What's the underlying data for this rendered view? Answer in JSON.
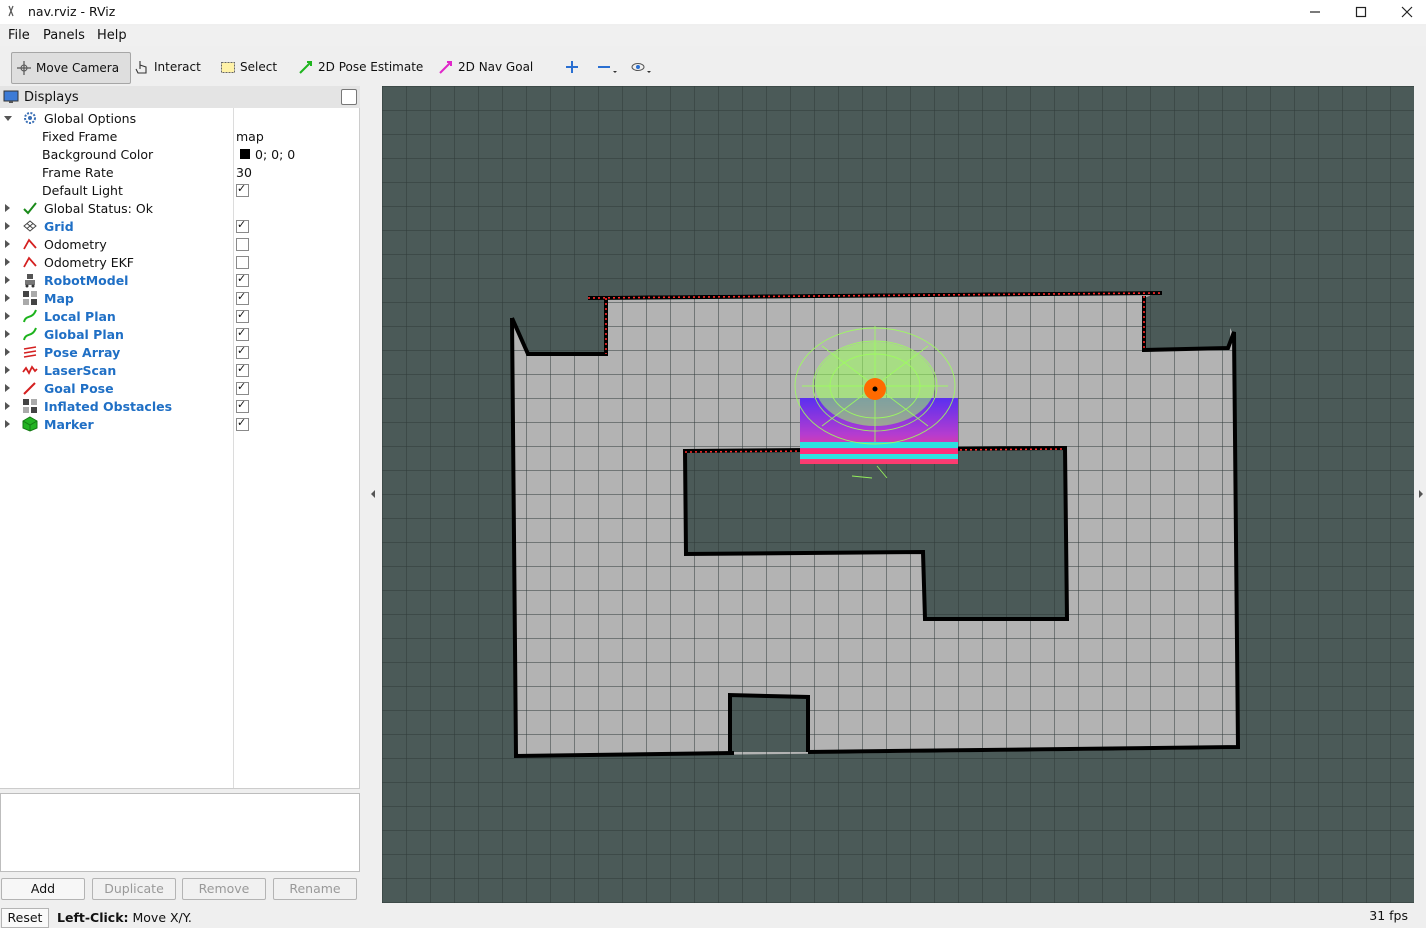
{
  "window": {
    "title": "nav.rviz - RViz"
  },
  "menu": {
    "file": "File",
    "panels": "Panels",
    "help": "Help"
  },
  "toolbar": {
    "move_camera": "Move Camera",
    "interact": "Interact",
    "select": "Select",
    "pose_estimate": "2D Pose Estimate",
    "nav_goal": "2D Nav Goal"
  },
  "displays": {
    "header": "Displays",
    "global_options": "Global Options",
    "fixed_frame_label": "Fixed Frame",
    "fixed_frame_value": "map",
    "bg_color_label": "Background Color",
    "bg_color_value": "0; 0; 0",
    "frame_rate_label": "Frame Rate",
    "frame_rate_value": "30",
    "default_light_label": "Default Light",
    "global_status": "Global Status: Ok",
    "items": [
      {
        "label": "Grid",
        "checked": true,
        "icon": "grid-icon"
      },
      {
        "label": "Odometry",
        "checked": false,
        "icon": "odometry-icon"
      },
      {
        "label": "Odometry EKF",
        "checked": false,
        "icon": "odometry-icon"
      },
      {
        "label": "RobotModel",
        "checked": true,
        "icon": "robot-icon"
      },
      {
        "label": "Map",
        "checked": true,
        "icon": "map-icon"
      },
      {
        "label": "Local Plan",
        "checked": true,
        "icon": "path-icon"
      },
      {
        "label": "Global Plan",
        "checked": true,
        "icon": "path-icon"
      },
      {
        "label": "Pose Array",
        "checked": true,
        "icon": "pose-array-icon"
      },
      {
        "label": "LaserScan",
        "checked": true,
        "icon": "laserscan-icon"
      },
      {
        "label": "Goal Pose",
        "checked": true,
        "icon": "goal-pose-icon"
      },
      {
        "label": "Inflated Obstacles",
        "checked": true,
        "icon": "map-icon"
      },
      {
        "label": "Marker",
        "checked": true,
        "icon": "marker-icon"
      }
    ]
  },
  "buttons": {
    "add": "Add",
    "duplicate": "Duplicate",
    "remove": "Remove",
    "rename": "Rename"
  },
  "status": {
    "reset": "Reset",
    "hint_bold": "Left-Click:",
    "hint": " Move X/Y.",
    "fps": "31 fps"
  },
  "colors": {
    "viewport_bg": "#4b5a58",
    "free_space": "#b3b3b3",
    "accent_blue": "#1f6fc5",
    "robot": "#ff6a00",
    "local_plan": "#9dff5c"
  }
}
